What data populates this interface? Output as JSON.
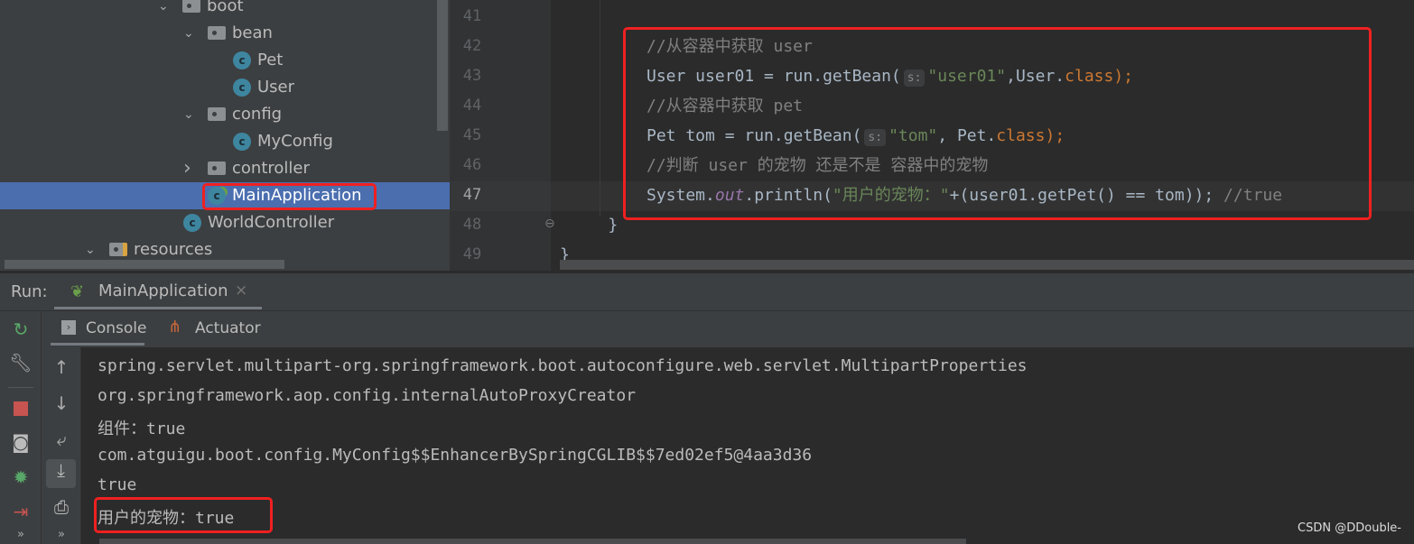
{
  "project_tree": {
    "items": [
      {
        "label": "boot",
        "type": "folder",
        "expanded": true
      },
      {
        "label": "bean",
        "type": "folder",
        "expanded": true
      },
      {
        "label": "Pet",
        "type": "class"
      },
      {
        "label": "User",
        "type": "class"
      },
      {
        "label": "config",
        "type": "folder",
        "expanded": true
      },
      {
        "label": "MyConfig",
        "type": "class"
      },
      {
        "label": "controller",
        "type": "folder",
        "expanded": false
      },
      {
        "label": "MainApplication",
        "type": "spring-boot-class",
        "selected": true
      },
      {
        "label": "WorldController",
        "type": "class"
      },
      {
        "label": "resources",
        "type": "resources-folder",
        "expanded": true
      }
    ]
  },
  "editor": {
    "line_numbers": [
      "41",
      "42",
      "43",
      "44",
      "45",
      "46",
      "47",
      "48",
      "49"
    ],
    "current_line": "47",
    "lines": [
      [],
      [
        {
          "t": "//从容器中获取 user",
          "c": "comment"
        }
      ],
      [
        {
          "t": "User user01 = run.getBean(",
          "c": "plain"
        },
        {
          "t": "s:",
          "c": "hint"
        },
        {
          "t": "\"user01\"",
          "c": "str"
        },
        {
          "t": ",User.",
          "c": "plain"
        },
        {
          "t": "class",
          "c": "kw"
        },
        {
          "t": ");",
          "c": "kw"
        }
      ],
      [
        {
          "t": "//从容器中获取 pet",
          "c": "comment"
        }
      ],
      [
        {
          "t": "Pet tom = run.getBean(",
          "c": "plain"
        },
        {
          "t": "s:",
          "c": "hint"
        },
        {
          "t": "\"tom\"",
          "c": "str"
        },
        {
          "t": ", Pet.",
          "c": "plain"
        },
        {
          "t": "class",
          "c": "kw"
        },
        {
          "t": ");",
          "c": "kw"
        }
      ],
      [
        {
          "t": "//判断 user 的宠物 还是不是 容器中的宠物",
          "c": "comment"
        }
      ],
      [
        {
          "t": "System.",
          "c": "plain"
        },
        {
          "t": "out",
          "c": "static"
        },
        {
          "t": ".println(",
          "c": "plain"
        },
        {
          "t": "\"用户的宠物：\"",
          "c": "str"
        },
        {
          "t": "+(user01.getPet() == tom));",
          "c": "plain"
        },
        {
          "t": " //true",
          "c": "comment"
        }
      ],
      [
        {
          "t": "    }",
          "c": "plain"
        }
      ],
      [
        {
          "t": "}",
          "c": "plain"
        }
      ]
    ]
  },
  "run_panel": {
    "run_label": "Run:",
    "config_tab": "MainApplication",
    "tabs": [
      {
        "label": "Console",
        "icon": "console-icon"
      },
      {
        "label": "Actuator",
        "icon": "actuator-icon"
      }
    ]
  },
  "console": {
    "lines": [
      "spring.servlet.multipart-org.springframework.boot.autoconfigure.web.servlet.MultipartProperties",
      "org.springframework.aop.config.internalAutoProxyCreator",
      "组件：true",
      "com.atguigu.boot.config.MyConfig$$EnhancerBySpringCGLIB$$7ed02ef5@4aa3d36",
      "true",
      "用户的宠物：true"
    ]
  },
  "watermark": "CSDN @DDouble-",
  "colors": {
    "highlight_box": "#f02020",
    "selection": "#4b6eaf"
  }
}
